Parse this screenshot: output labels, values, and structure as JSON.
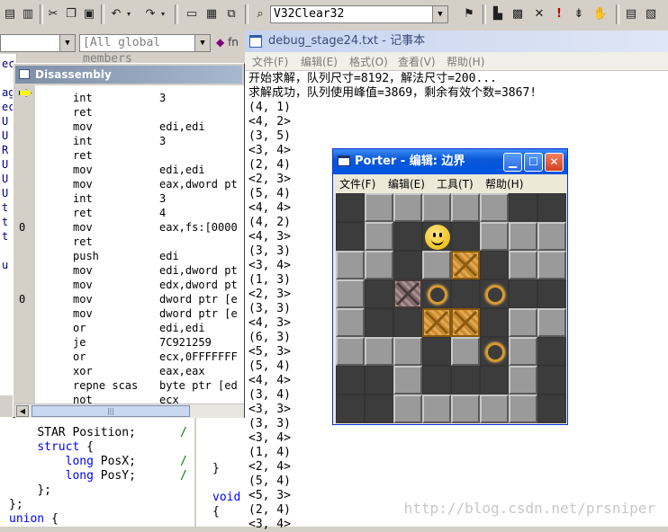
{
  "ide": {
    "config_combo": "V32Clear32",
    "members_combo": "[All global members",
    "fn_label": "fn",
    "left_strip_chars": [
      "ec",
      "ag",
      "ec",
      "U",
      "U",
      "R",
      "U",
      "U",
      "U",
      "t",
      "t",
      "t",
      "u"
    ]
  },
  "disassembly": {
    "title": "Disassembly",
    "rows": [
      {
        "addr": "",
        "mn": "int",
        "op": "3"
      },
      {
        "addr": "",
        "mn": "ret",
        "op": ""
      },
      {
        "addr": "",
        "mn": "mov",
        "op": "edi,edi"
      },
      {
        "addr": "",
        "mn": "int",
        "op": "3"
      },
      {
        "addr": "",
        "mn": "ret",
        "op": ""
      },
      {
        "addr": "",
        "mn": "mov",
        "op": "edi,edi"
      },
      {
        "addr": "",
        "mn": "mov",
        "op": "eax,dword pt"
      },
      {
        "addr": "",
        "mn": "int",
        "op": "3"
      },
      {
        "addr": "",
        "mn": "ret",
        "op": "4"
      },
      {
        "addr": "0",
        "mn": "mov",
        "op": "eax,fs:[0000"
      },
      {
        "addr": "",
        "mn": "ret",
        "op": ""
      },
      {
        "addr": "",
        "mn": "push",
        "op": "edi"
      },
      {
        "addr": "",
        "mn": "mov",
        "op": "edi,dword pt"
      },
      {
        "addr": "",
        "mn": "mov",
        "op": "edx,dword pt"
      },
      {
        "addr": "0",
        "mn": "mov",
        "op": "dword ptr [e"
      },
      {
        "addr": "",
        "mn": "mov",
        "op": "dword ptr [e"
      },
      {
        "addr": "",
        "mn": "or",
        "op": "edi,edi"
      },
      {
        "addr": "",
        "mn": "je",
        "op": "7C921259"
      },
      {
        "addr": "",
        "mn": "or",
        "op": "ecx,0FFFFFFF"
      },
      {
        "addr": "",
        "mn": "xor",
        "op": "eax,eax"
      },
      {
        "addr": "",
        "mn": "repne scas",
        "op": "byte ptr [ed"
      },
      {
        "addr": "",
        "mn": "not",
        "op": "ecx"
      }
    ]
  },
  "code": {
    "lines": [
      {
        "indent": "    ",
        "kw": "",
        "text": "STAR Position;",
        "cmt": "/"
      },
      {
        "indent": "    ",
        "kw": "struct",
        "text": " {",
        "cmt": ""
      },
      {
        "indent": "        ",
        "kw": "long",
        "text": " PosX;",
        "cmt": "/"
      },
      {
        "indent": "        ",
        "kw": "long",
        "text": " PosY;",
        "cmt": "/"
      },
      {
        "indent": "    ",
        "kw": "",
        "text": "};",
        "cmt": ""
      },
      {
        "indent": "",
        "kw": "",
        "text": "};",
        "cmt": ""
      },
      {
        "indent": "",
        "kw": "union",
        "text": " {",
        "cmt": ""
      }
    ],
    "right_lines": [
      "}",
      "",
      "void",
      "{"
    ]
  },
  "notepad": {
    "title": "debug_stage24.txt - 记事本",
    "menu": [
      "文件(F)",
      "编辑(E)",
      "格式(O)",
      "查看(V)",
      "帮助(H)"
    ],
    "lines": [
      "开始求解，队列尺寸=8192，解法尺寸=200...",
      "求解成功，队列使用峰值=3869，剩余有效个数=3867!",
      "(4, 1)",
      "<4, 2>",
      "(3, 5)",
      "<3, 4>",
      "(2, 4)",
      "<2, 3>",
      "(5, 4)",
      "<4, 4>",
      "(4, 2)",
      "<4, 3>",
      "(3, 3)",
      "<3, 4>",
      "(1, 3)",
      "<2, 3>",
      "(3, 3)",
      "<4, 3>",
      "(6, 3)",
      "<5, 3>",
      "(5, 4)",
      "<4, 4>",
      "(3, 4)",
      "<3, 3>",
      "(3, 3)",
      "<3, 4>",
      "(1, 4)",
      "<2, 4>",
      "(5, 4)",
      "<5, 3>",
      "(2, 4)",
      "<3, 4>"
    ]
  },
  "porter": {
    "title": "Porter - 编辑: 边界",
    "menu": [
      "文件(F)",
      "编辑(E)",
      "工具(T)",
      "帮助(H)"
    ],
    "legend": {
      "W": "wall",
      "F": "floor",
      "G": "goal",
      "B": "box",
      "X": "box-on-goal",
      "P": "player"
    },
    "board": [
      "FWWWWWFF",
      "FWFPFWWW",
      "WWFWBFWW",
      "WFXGFGFF",
      "WFFBBFWW",
      "WWWFWGWF",
      "FFWFFFWF",
      "FFWWWWWF"
    ]
  },
  "watermark": "http://blog.csdn.net/prsniper"
}
